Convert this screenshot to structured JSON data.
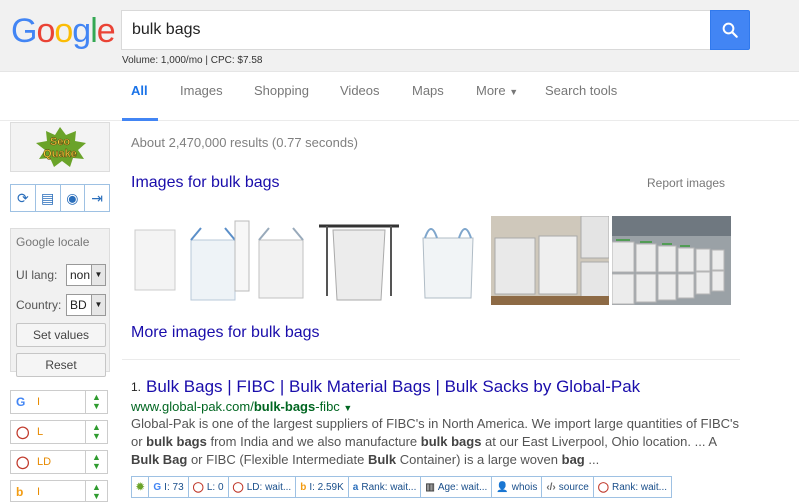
{
  "header": {
    "logo_letters": [
      {
        "ch": "G",
        "color": "#4285f4"
      },
      {
        "ch": "o",
        "color": "#ea4335"
      },
      {
        "ch": "o",
        "color": "#fbbc05"
      },
      {
        "ch": "g",
        "color": "#4285f4"
      },
      {
        "ch": "l",
        "color": "#34a853"
      },
      {
        "ch": "e",
        "color": "#ea4335"
      }
    ],
    "search_query": "bulk bags",
    "search_icon": "magnifier-icon",
    "volume_text": "Volume: 1,000/mo | CPC: $7.58"
  },
  "tabs": [
    "All",
    "Images",
    "Shopping",
    "Videos",
    "Maps",
    "More",
    "Search tools"
  ],
  "active_tab": "All",
  "sidebar": {
    "logo_text": "SeoQuake",
    "tool_icons": [
      "refresh-icon",
      "clipboard-icon",
      "eye-icon",
      "export-icon"
    ],
    "locale": {
      "title": "Google locale",
      "ui_lang_label": "UI lang:",
      "ui_lang_value": "non",
      "country_label": "Country:",
      "country_value": "BD",
      "set_values": "Set values",
      "reset": "Reset"
    },
    "params": [
      {
        "icon": "G",
        "icon_color": "#4285f4",
        "label": "I"
      },
      {
        "icon": "◯",
        "icon_color": "#c0392b",
        "label": "L"
      },
      {
        "icon": "◯",
        "icon_color": "#c0392b",
        "label": "LD"
      },
      {
        "icon": "b",
        "icon_color": "#f39c12",
        "label": "I"
      }
    ]
  },
  "results_count": "About 2,470,000 results (0.77 seconds)",
  "images_section": {
    "title": "Images for bulk bags",
    "report": "Report images",
    "more": "More images for bulk bags"
  },
  "result": {
    "number": "1.",
    "title": "Bulk Bags | FIBC | Bulk Material Bags | Bulk Sacks by Global-Pak",
    "url_prefix": "www.global-pak.com/",
    "url_bold": "bulk-bags",
    "url_suffix": "-fibc",
    "snippet_parts": [
      {
        "t": "Global-Pak is one of the largest suppliers of FIBC's in North America. We import large quantities of FIBC's or ",
        "b": false
      },
      {
        "t": "bulk bags",
        "b": true
      },
      {
        "t": " from India and we also manufacture ",
        "b": false
      },
      {
        "t": "bulk bags",
        "b": true
      },
      {
        "t": " at our East Liverpool, Ohio location. ... A ",
        "b": false
      },
      {
        "t": "Bulk Bag",
        "b": true
      },
      {
        "t": " or FIBC (Flexible Intermediate ",
        "b": false
      },
      {
        "t": "Bulk",
        "b": true
      },
      {
        "t": " Container) is a large woven ",
        "b": false
      },
      {
        "t": "bag",
        "b": true
      },
      {
        "t": " ...",
        "b": false
      }
    ]
  },
  "seoquake_bar": [
    {
      "icon": "seoquake-icon",
      "text": ""
    },
    {
      "icon": "google-icon",
      "text": "I: 73"
    },
    {
      "icon": "circle-icon",
      "text": "L: 0"
    },
    {
      "icon": "circle-icon",
      "text": "LD: wait..."
    },
    {
      "icon": "bing-icon",
      "text": "I: 2.59K"
    },
    {
      "icon": "alexa-icon",
      "text": "Rank: wait..."
    },
    {
      "icon": "archive-icon",
      "text": "Age: wait..."
    },
    {
      "icon": "person-icon",
      "text": "whois"
    },
    {
      "icon": "code-icon",
      "text": "source"
    },
    {
      "icon": "circle-icon",
      "text": "Rank: wait..."
    }
  ]
}
